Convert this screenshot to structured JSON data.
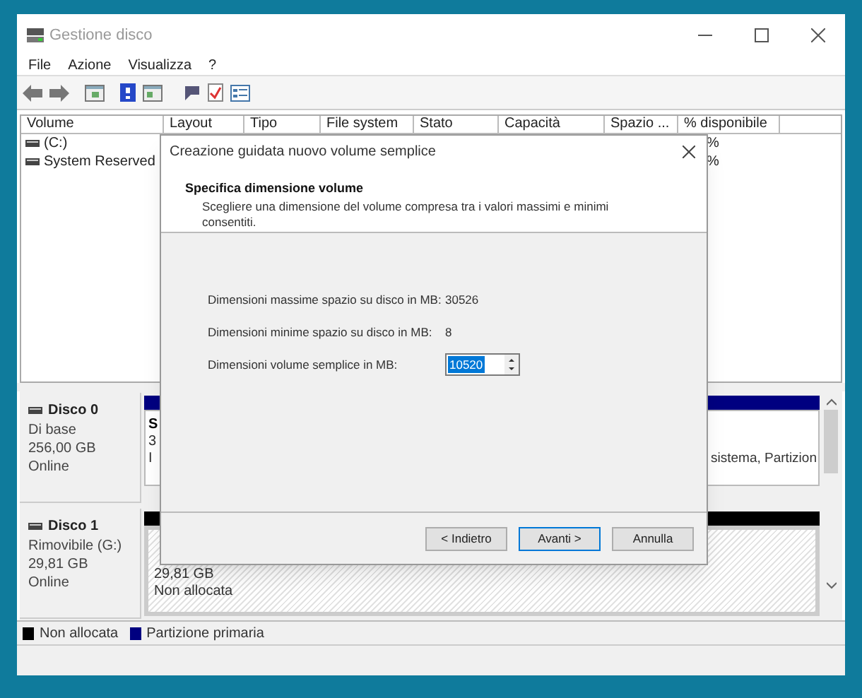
{
  "window": {
    "title": "Gestione disco"
  },
  "menu": [
    {
      "label": "File"
    },
    {
      "label": "Azione"
    },
    {
      "label": "Visualizza"
    },
    {
      "label": "?"
    }
  ],
  "table": {
    "columns": [
      "Volume",
      "Layout",
      "Tipo",
      "File system",
      "Stato",
      "Capacità",
      "Spazio ...",
      "% disponibile"
    ],
    "rows": [
      {
        "volume": "(C:)",
        "column_8": "%"
      },
      {
        "volume": "System Reserved",
        "column_8": "%"
      }
    ]
  },
  "disks": [
    {
      "name": "Disco 0",
      "type": "Di base",
      "size": "256,00 GB",
      "status": "Online",
      "kind": "primary",
      "color": "#000080",
      "lines": [
        "S",
        "3",
        "I"
      ],
      "detail": "sistema, Partizion"
    },
    {
      "name": "Disco 1",
      "type": "Rimovibile (G:)",
      "size": "29,81 GB",
      "status": "Online",
      "kind": "unallocated",
      "color": "#000000",
      "lines": [
        "29,81 GB",
        "Non allocata"
      ]
    }
  ],
  "legend": [
    {
      "label": "Non allocata",
      "color": "#000000"
    },
    {
      "label": "Partizione primaria",
      "color": "#000080"
    }
  ],
  "dialog": {
    "title": "Creazione guidata nuovo volume semplice",
    "heading": "Specifica dimensione volume",
    "description": "Scegliere una dimensione del volume compresa tra i valori massimi e minimi consentiti.",
    "fields": [
      {
        "kind": "text",
        "label": "Dimensioni massime spazio su disco in MB:",
        "value": "30526"
      },
      {
        "kind": "text",
        "label": "Dimensioni minime spazio su disco in MB:",
        "value": "8"
      },
      {
        "kind": "spin",
        "label": "Dimensioni volume semplice in MB:",
        "value": "10520"
      }
    ],
    "buttons": [
      {
        "label": "< Indietro",
        "focused": false
      },
      {
        "label": "Avanti >",
        "focused": true
      },
      {
        "label": "Annulla",
        "focused": false
      }
    ]
  }
}
